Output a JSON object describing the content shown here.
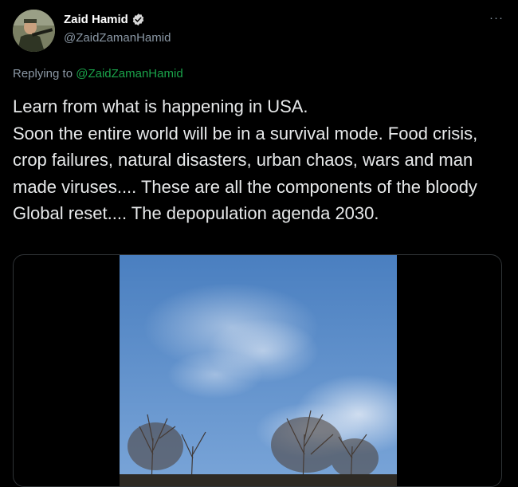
{
  "author": {
    "display_name": "Zaid Hamid",
    "handle": "@ZaidZamanHamid",
    "verified_icon": "verified-badge-icon"
  },
  "more_menu": {
    "label": "···",
    "icon": "more-horizontal-icon"
  },
  "reply": {
    "prefix": "Replying to ",
    "to_handle": "@ZaidZamanHamid"
  },
  "tweet": {
    "line1": "Learn from what is happening in USA.",
    "line2": "Soon the entire world will be in a survival mode. Food crisis, crop failures, natural disasters, urban chaos, wars and man made viruses.... These are all the components of the bloody Global reset.... The depopulation agenda 2030."
  },
  "media": {
    "type": "video",
    "description_icon": "video-thumbnail"
  },
  "colors": {
    "background": "#000000",
    "text": "#e7e9ea",
    "secondary": "#8b98a5",
    "reply_link": "#1aa34a",
    "verified": "#d9d9d9"
  }
}
